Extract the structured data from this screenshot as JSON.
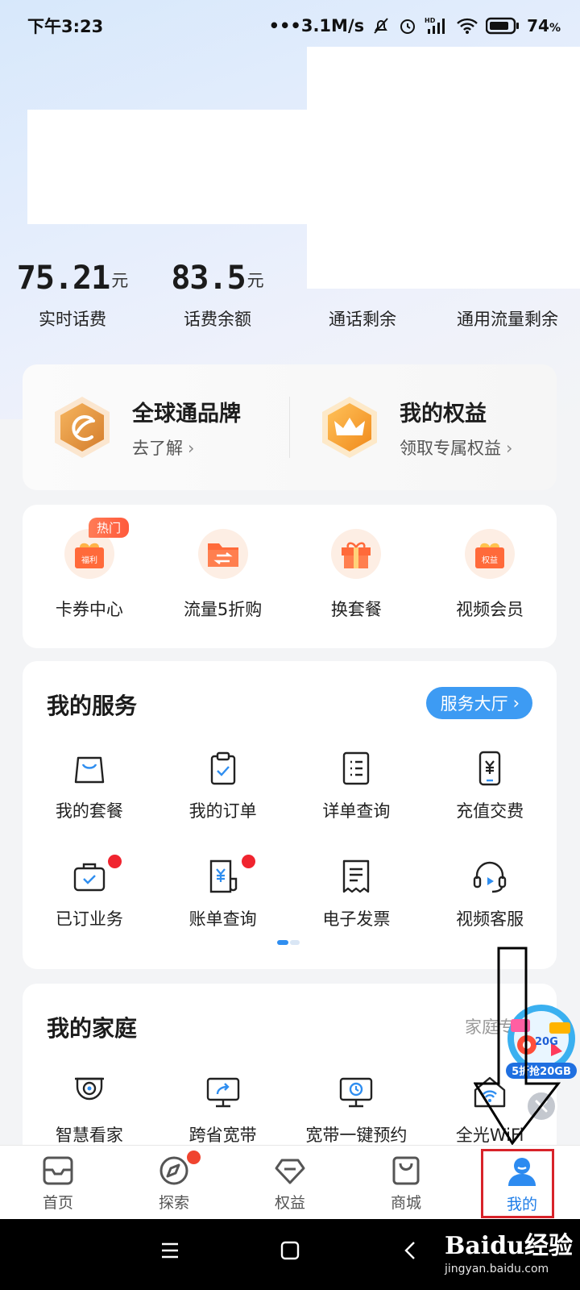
{
  "status_bar": {
    "time": "下午3:23",
    "network_speed": "•••3.1M/s",
    "battery": "74",
    "battery_unit": "%"
  },
  "stats": [
    {
      "value": "75.21",
      "unit": "元",
      "label": "实时话费"
    },
    {
      "value": "83.5",
      "unit": "元",
      "label": "话费余额"
    },
    {
      "value": "",
      "unit": "",
      "label": "通话剩余"
    },
    {
      "value": "",
      "unit": "",
      "label": "通用流量剩余"
    }
  ],
  "promo": {
    "left": {
      "title": "全球通品牌",
      "subtitle": "去了解",
      "icon": "globe-brand-hex-icon"
    },
    "right": {
      "title": "我的权益",
      "subtitle": "领取专属权益",
      "icon": "crown-hex-icon"
    }
  },
  "quick_actions": {
    "hot_tag": "热门",
    "items": [
      {
        "label": "卡券中心",
        "icon": "gift-box-icon",
        "badge_text": "福利"
      },
      {
        "label": "流量5折购",
        "icon": "folder-exchange-icon"
      },
      {
        "label": "换套餐",
        "icon": "present-icon"
      },
      {
        "label": "视频会员",
        "icon": "gift-box-icon",
        "badge_text": "权益"
      }
    ]
  },
  "services": {
    "title": "我的服务",
    "hall_button": "服务大厅",
    "items": [
      {
        "label": "我的套餐",
        "icon": "bag-icon"
      },
      {
        "label": "我的订单",
        "icon": "clipboard-check-icon"
      },
      {
        "label": "详单查询",
        "icon": "list-doc-icon"
      },
      {
        "label": "充值交费",
        "icon": "phone-yuan-icon"
      },
      {
        "label": "已订业务",
        "icon": "briefcase-check-icon"
      },
      {
        "label": "账单查询",
        "icon": "bill-yuan-icon"
      },
      {
        "label": "电子发票",
        "icon": "receipt-icon"
      },
      {
        "label": "视频客服",
        "icon": "headset-play-icon"
      }
    ]
  },
  "family": {
    "title": "我的家庭",
    "link": "家庭专区",
    "items": [
      {
        "label": "智慧看家",
        "icon": "camera-icon"
      },
      {
        "label": "跨省宽带",
        "icon": "monitor-share-icon"
      },
      {
        "label": "宽带一键预约",
        "icon": "monitor-clock-icon"
      },
      {
        "label": "全光WiFi",
        "icon": "home-wifi-icon"
      }
    ]
  },
  "floating_ad": {
    "text": "5折抢20GB",
    "chip": "20G"
  },
  "tabs": [
    {
      "label": "首页",
      "icon": "home-icon"
    },
    {
      "label": "探索",
      "icon": "compass-icon"
    },
    {
      "label": "权益",
      "icon": "diamond-icon"
    },
    {
      "label": "商城",
      "icon": "shopping-bag-icon"
    },
    {
      "label": "我的",
      "icon": "profile-icon",
      "active": true
    }
  ],
  "watermark": {
    "logo": "Baidu经验",
    "url": "jingyan.baidu.com"
  },
  "colors": {
    "accent": "#3d9bf3",
    "active_tab": "#1e7de8",
    "badge_red": "#f0242f",
    "orange": "#ff6a3a"
  }
}
